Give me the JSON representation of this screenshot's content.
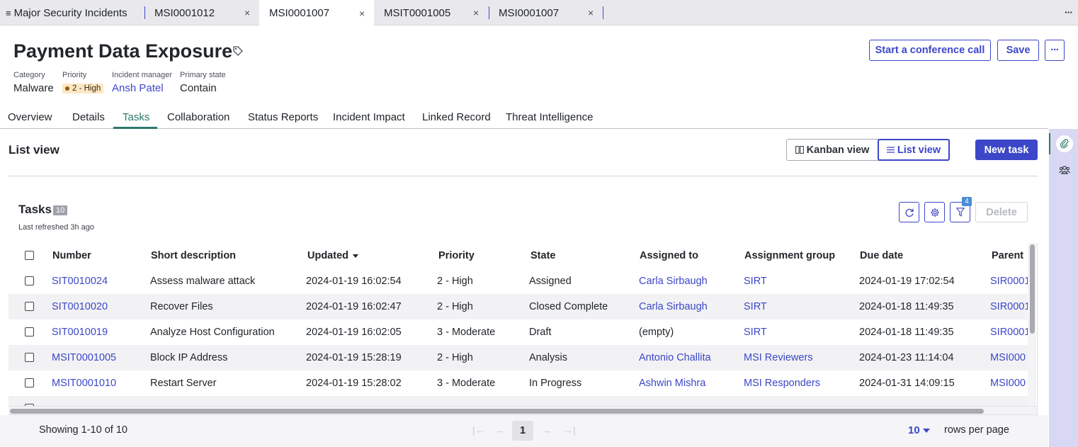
{
  "tabstrip": {
    "tabs": [
      {
        "label": "Major Security Incidents",
        "has_menu_icon": true,
        "active": false
      },
      {
        "label": "MSI0001012",
        "active": false
      },
      {
        "label": "MSI0001007",
        "active": true
      },
      {
        "label": "MSIT0001005",
        "active": false
      },
      {
        "label": "MSI0001007",
        "active": false
      }
    ],
    "close_glyph": "×",
    "more_glyph": "···"
  },
  "record": {
    "title": "Payment Data Exposure",
    "fields": [
      {
        "label": "Category",
        "value": "Malware"
      },
      {
        "label": "Priority",
        "value": "2 - High"
      },
      {
        "label": "Incident manager",
        "value": "Ansh Patel"
      },
      {
        "label": "Primary state",
        "value": "Contain"
      }
    ]
  },
  "header_actions": {
    "conference_label": "Start a conference call",
    "save_label": "Save",
    "more_label": "···"
  },
  "section_tabs": [
    "Overview",
    "Details",
    "Tasks",
    "Collaboration",
    "Status Reports",
    "Incident Impact",
    "Linked Record",
    "Threat Intelligence"
  ],
  "section_active": "Tasks",
  "list_view": {
    "title": "List view",
    "kanban_label": "Kanban view",
    "list_label": "List view",
    "new_task_label": "New task"
  },
  "tasks": {
    "heading": "Tasks",
    "count": "10",
    "last_refreshed": "Last refreshed 3h ago",
    "filter_count": "4",
    "delete_label": "Delete",
    "columns": [
      "Number",
      "Short description",
      "Updated",
      "Priority",
      "State",
      "Assigned to",
      "Assignment group",
      "Due date",
      "Parent"
    ],
    "sorted_column": "Updated",
    "rows": [
      {
        "number": "SIT0010024",
        "description": "Assess malware attack",
        "updated": "2024-01-19 16:02:54",
        "priority": "2 - High",
        "state": "Assigned",
        "assigned_to": "Carla Sirbaugh",
        "group": "SIRT",
        "due": "2024-01-19 17:02:54",
        "parent": "SIR0001"
      },
      {
        "number": "SIT0010020",
        "description": "Recover Files",
        "updated": "2024-01-19 16:02:47",
        "priority": "2 - High",
        "state": "Closed Complete",
        "assigned_to": "Carla Sirbaugh",
        "group": "SIRT",
        "due": "2024-01-18 11:49:35",
        "parent": "SIR0001"
      },
      {
        "number": "SIT0010019",
        "description": "Analyze Host Configuration",
        "updated": "2024-01-19 16:02:05",
        "priority": "3 - Moderate",
        "state": "Draft",
        "assigned_to": "(empty)",
        "group": "SIRT",
        "due": "2024-01-18 11:49:35",
        "parent": "SIR0001"
      },
      {
        "number": "MSIT0001005",
        "description": "Block IP Address",
        "updated": "2024-01-19 15:28:19",
        "priority": "2 - High",
        "state": "Analysis",
        "assigned_to": "Antonio Challita",
        "group": "MSI Reviewers",
        "due": "2024-01-23 11:14:04",
        "parent": "MSI000"
      },
      {
        "number": "MSIT0001010",
        "description": "Restart Server",
        "updated": "2024-01-19 15:28:02",
        "priority": "3 - Moderate",
        "state": "In Progress",
        "assigned_to": "Ashwin Mishra",
        "group": "MSI Responders",
        "due": "2024-01-31 14:09:15",
        "parent": "MSI000"
      }
    ]
  },
  "pagination": {
    "showing": "Showing 1-10 of 10",
    "current_page": "1",
    "rows_per_page_value": "10",
    "rows_per_page_label": "rows per page"
  },
  "colors": {
    "accent": "#3c47c8",
    "active_tab_underline": "#2a7a6b",
    "priority_badge_bg": "#fde7c4",
    "rail_bg": "#d8d8f4"
  },
  "icons": [
    "menu-icon",
    "close-icon",
    "tag-icon",
    "kanban-icon",
    "list-icon",
    "refresh-icon",
    "gear-icon",
    "filter-icon",
    "paperclip-icon",
    "people-icon",
    "first-page-icon",
    "prev-page-icon",
    "next-page-icon",
    "last-page-icon"
  ]
}
